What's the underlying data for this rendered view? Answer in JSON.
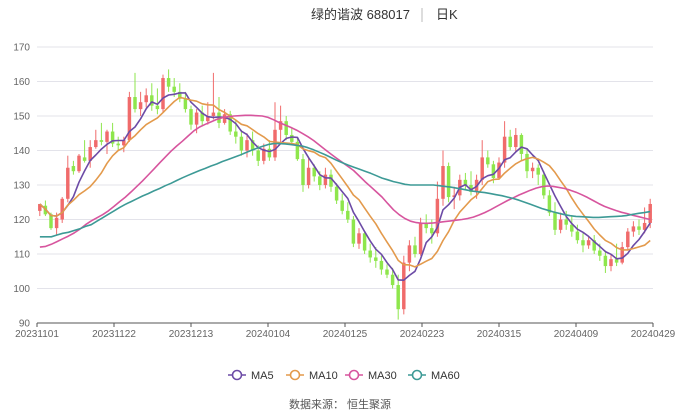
{
  "header": {
    "name_code": "绿的谐波 688017",
    "period": "日K"
  },
  "source": "数据来源： 恒生聚源",
  "chart_data": {
    "type": "candlestick",
    "title": "绿的谐波 688017",
    "period_label": "日K",
    "ylim": [
      90,
      170
    ],
    "yticks": [
      90,
      100,
      110,
      120,
      130,
      140,
      150,
      160,
      170
    ],
    "xticks": [
      "20231101",
      "20231122",
      "20231213",
      "20240104",
      "20240125",
      "20240223",
      "20240315",
      "20240409",
      "20240429"
    ],
    "up_color": "#f06b6b",
    "down_color": "#8ee64c",
    "grid": true,
    "legend_position": "bottom",
    "candles": [],
    "series": [
      {
        "name": "MA5",
        "color": "#6c4ba6",
        "values": []
      },
      {
        "name": "MA10",
        "color": "#e39a4c",
        "values": []
      },
      {
        "name": "MA30",
        "color": "#d7559e",
        "values": []
      },
      {
        "name": "MA60",
        "color": "#3d9a96",
        "values": []
      }
    ]
  }
}
